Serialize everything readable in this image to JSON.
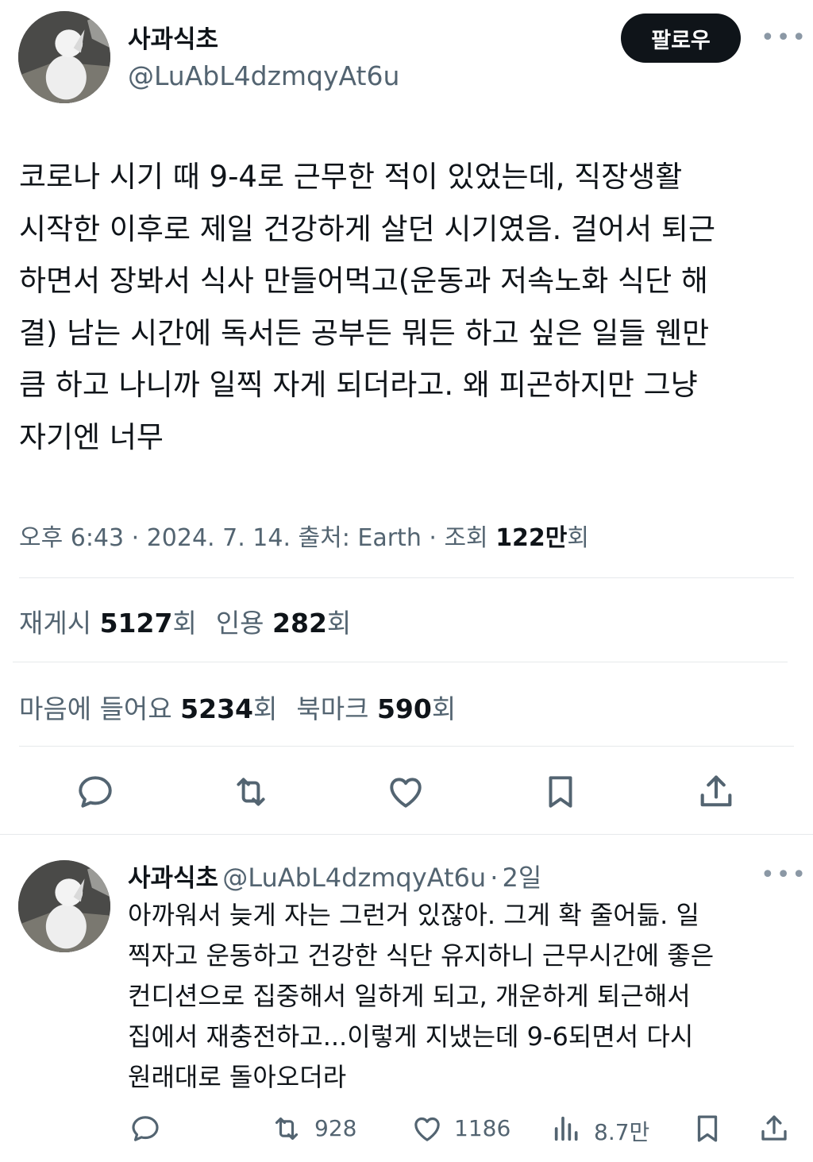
{
  "author": {
    "name": "사과식초",
    "handle": "@LuAbL4dzmqyAt6u"
  },
  "follow_label": "팔로우",
  "more_label": "•••",
  "tweet": {
    "lines": [
      "코로나 시기 때 9-4로 근무한 적이 있었는데, 직장생활",
      "시작한 이후로 제일 건강하게 살던 시기였음. 걸어서 퇴근",
      "하면서 장봐서 식사 만들어먹고(운동과 저속노화 식단 해",
      "결) 남는 시간에 독서든 공부든 뭐든 하고 싶은 일들 웬만",
      "큼 하고 나니까 일찍 자게 되더라고. 왜 피곤하지만 그냥",
      "자기엔 너무"
    ],
    "meta_prefix": "오후 6:43 · 2024. 7. 14. 출처: Earth · 조회 ",
    "views": "122만",
    "views_suffix": "회"
  },
  "stats": {
    "repost_label": "재게시 ",
    "repost_count": "5127",
    "repost_unit": "회",
    "quote_label": "인용 ",
    "quote_count": "282",
    "quote_unit": "회",
    "like_label": "마음에 들어요 ",
    "like_count": "5234",
    "like_unit": "회",
    "bookmark_label": "북마크 ",
    "bookmark_count": "590",
    "bookmark_unit": "회"
  },
  "actions": {
    "reply_icon": "reply-icon",
    "retweet_icon": "retweet-icon",
    "like_icon": "heart-icon",
    "bookmark_icon": "bookmark-icon",
    "share_icon": "share-icon"
  },
  "reply": {
    "name": "사과식초",
    "handle": "@LuAbL4dzmqyAt6u",
    "sep": "·",
    "time": "2일",
    "lines": [
      "아까워서 늦게 자는 그런거 있잖아. 그게 확 줄어듦. 일",
      "찍자고 운동하고 건강한 식단 유지하니 근무시간에 좋은",
      "컨디션으로 집중해서 일하게 되고, 개운하게 퇴근해서",
      "집에서 재충전하고...이렇게 지냈는데 9-6되면서 다시",
      "원래대로 돌아오더라"
    ],
    "retweets": "928",
    "likes": "1186",
    "views": "8.7만"
  },
  "colors": {
    "text": "#0f1419",
    "secondary": "#536471",
    "divider": "#e6e9eb",
    "button": "#0f1419"
  }
}
